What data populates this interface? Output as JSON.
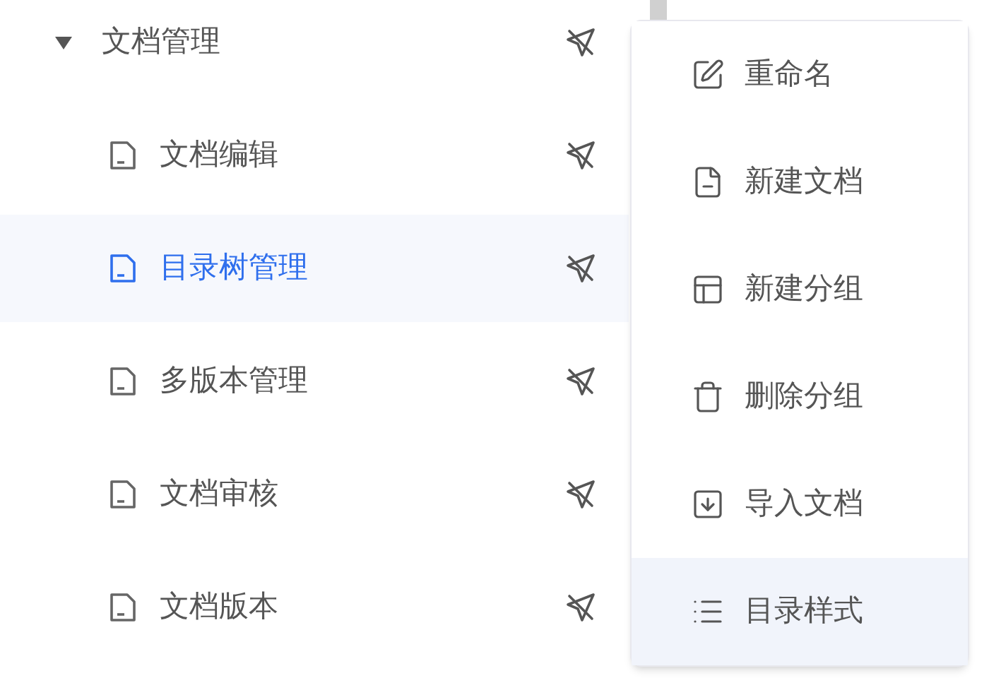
{
  "tree": {
    "label": "文档管理",
    "expanded": true,
    "children": [
      {
        "label": "文档编辑",
        "selected": false
      },
      {
        "label": "目录树管理",
        "selected": true
      },
      {
        "label": "多版本管理",
        "selected": false
      },
      {
        "label": "文档审核",
        "selected": false
      },
      {
        "label": "文档版本",
        "selected": false
      }
    ]
  },
  "context_menu": {
    "items": [
      {
        "label": "重命名",
        "selected": false
      },
      {
        "label": "新建文档",
        "selected": false
      },
      {
        "label": "新建分组",
        "selected": false
      },
      {
        "label": "删除分组",
        "selected": false
      },
      {
        "label": "导入文档",
        "selected": false
      },
      {
        "label": "目录样式",
        "selected": true
      }
    ]
  }
}
